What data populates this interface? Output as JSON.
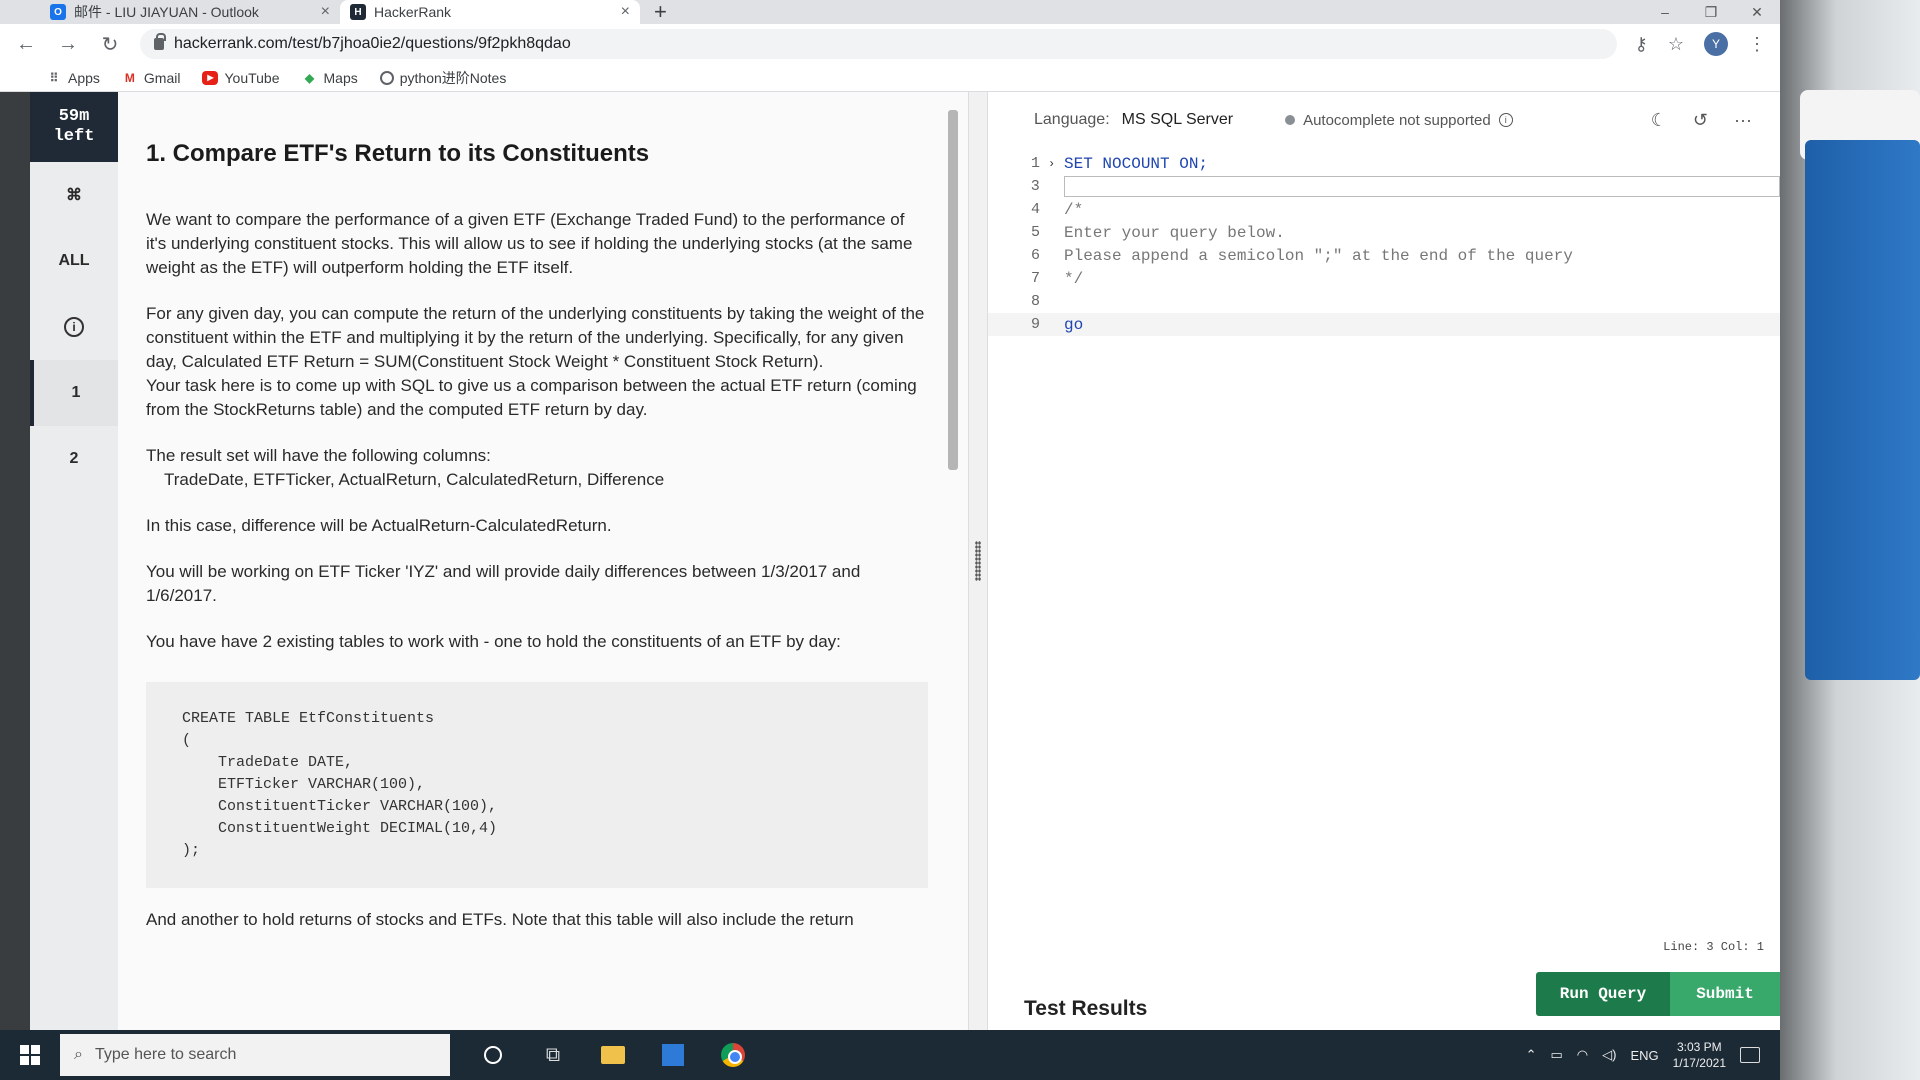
{
  "browser": {
    "tabs": [
      {
        "icon": "outlook-icon",
        "favicon": "O",
        "title": "邮件 - LIU JIAYUAN - Outlook",
        "active": false
      },
      {
        "icon": "hackerrank-icon",
        "favicon": "H",
        "title": "HackerRank",
        "active": true
      }
    ],
    "url": "hackerrank.com/test/b7jhoa0ie2/questions/9f2pkh8qdao",
    "avatar_letter": "Y",
    "bookmarks": [
      {
        "icon": "apps-icon",
        "label": "Apps"
      },
      {
        "icon": "gmail-icon",
        "label": "Gmail"
      },
      {
        "icon": "youtube-icon",
        "label": "YouTube"
      },
      {
        "icon": "maps-icon",
        "label": "Maps"
      },
      {
        "icon": "globe-icon",
        "label": "python进阶Notes"
      }
    ]
  },
  "sidebar": {
    "timer_line1": "59m",
    "timer_line2": "left",
    "items": [
      {
        "icon": "command-icon",
        "label": "⌘"
      },
      {
        "label": "ALL"
      },
      {
        "icon": "info-icon",
        "label": "i"
      },
      {
        "label": "1"
      },
      {
        "label": "2"
      }
    ]
  },
  "problem": {
    "title": "1. Compare ETF's Return to its Constituents",
    "paragraphs": {
      "p1": "We want to compare the performance of a given ETF (Exchange Traded Fund) to the performance of it's underlying constituent stocks.  This will allow us to see if holding the underlying stocks (at the same weight as the ETF) will outperform holding the ETF itself.",
      "p2": "For any given day, you can compute the return of the underlying constituents by taking the weight of the constituent within the ETF and multiplying it by the return of the underlying.  Specifically, for any given day, Calculated ETF Return = SUM(Constituent Stock Weight * Constituent Stock Return).",
      "p3": "Your task here is to come up with SQL to give us a comparison between the actual ETF return (coming from the StockReturns table) and the computed ETF return by day.",
      "p4": "The result set will have the following columns:",
      "p4_cols": "TradeDate, ETFTicker, ActualReturn, CalculatedReturn, Difference",
      "p5": "In this case, difference will be ActualReturn-CalculatedReturn.",
      "p6": "You will be working on ETF Ticker 'IYZ' and will provide daily differences between 1/3/2017 and 1/6/2017.",
      "p7": "You have have 2 existing tables to work with - one to hold the constituents of an ETF by day:",
      "code": "CREATE TABLE EtfConstituents\n(\n    TradeDate DATE,\n    ETFTicker VARCHAR(100),\n    ConstituentTicker VARCHAR(100),\n    ConstituentWeight DECIMAL(10,4)\n);",
      "p8": "And another to hold returns of stocks and ETFs.  Note that this table will also include the return"
    }
  },
  "editor": {
    "language_label": "Language:",
    "language_value": "MS SQL Server",
    "autocomplete": "Autocomplete not supported",
    "lines": [
      {
        "n": "1",
        "text": "SET NOCOUNT ON;",
        "style": "kw",
        "fold": "›"
      },
      {
        "n": "3",
        "text": "",
        "style": "",
        "fold": ""
      },
      {
        "n": "4",
        "text": "/*",
        "style": "cm",
        "fold": ""
      },
      {
        "n": "5",
        "text": "Enter your query below.",
        "style": "cm",
        "fold": ""
      },
      {
        "n": "6",
        "text": "Please append a semicolon \";\" at the end of the query",
        "style": "cm",
        "fold": ""
      },
      {
        "n": "7",
        "text": "*/",
        "style": "cm",
        "fold": ""
      },
      {
        "n": "8",
        "text": "",
        "style": "",
        "fold": ""
      },
      {
        "n": "9",
        "text": "go",
        "style": "kw",
        "fold": ""
      }
    ],
    "status": "Line: 3 Col: 1",
    "test_results": "Test Results",
    "run_label": "Run Query",
    "submit_label": "Submit"
  },
  "taskbar": {
    "search_placeholder": "Type here to search",
    "lang": "ENG",
    "time": "3:03 PM",
    "date": "1/17/2021"
  }
}
